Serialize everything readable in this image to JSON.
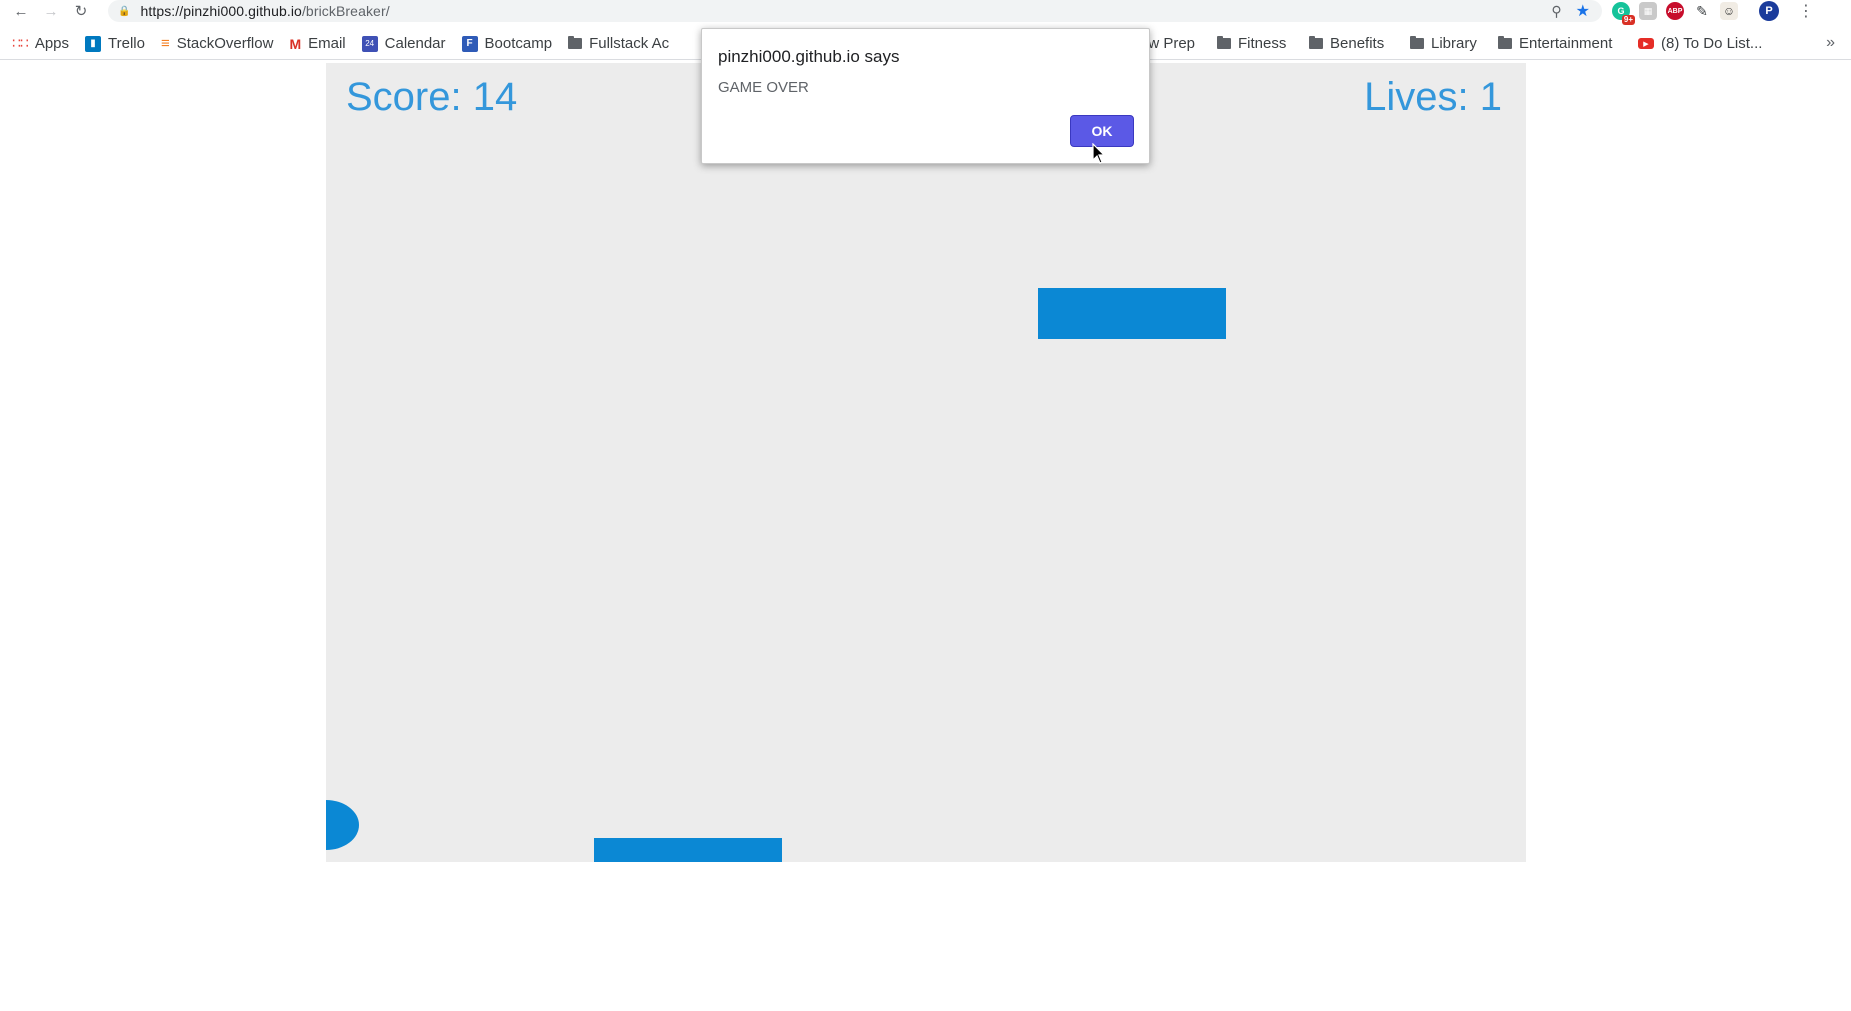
{
  "browser": {
    "url_host": "https://pinzhi000.github.io",
    "url_path": "/brickBreaker/",
    "icons": [
      "back-arrow-icon",
      "forward-arrow-icon",
      "reload-icon",
      "lock-icon",
      "zoom-icon",
      "star-icon",
      "menu-dots-icon"
    ],
    "extensions": {
      "grammarly_badge": "9+",
      "abp": "ABP",
      "profile_initial": "P"
    }
  },
  "bookmarks": [
    {
      "label": "Apps",
      "icon": "apps-grid-icon"
    },
    {
      "label": "Trello",
      "icon": "trello-icon"
    },
    {
      "label": "StackOverflow",
      "icon": "stackoverflow-icon"
    },
    {
      "label": "Email",
      "icon": "gmail-icon"
    },
    {
      "label": "Calendar",
      "icon": "calendar-icon"
    },
    {
      "label": "Bootcamp",
      "icon": "fullstack-icon"
    },
    {
      "label": "Fullstack Ac",
      "icon": "folder-icon"
    },
    {
      "label": "ew Prep",
      "icon": "folder-icon"
    },
    {
      "label": "Fitness",
      "icon": "folder-icon"
    },
    {
      "label": "Benefits",
      "icon": "folder-icon"
    },
    {
      "label": "Library",
      "icon": "folder-icon"
    },
    {
      "label": "Entertainment",
      "icon": "folder-icon"
    },
    {
      "label": "(8) To Do List...",
      "icon": "youtube-icon"
    }
  ],
  "bookmarks_overflow": "»",
  "game": {
    "score_label": "Score: 14",
    "lives_label": "Lives: 1",
    "accent_color": "#0b88d4",
    "hud_color": "#3497db",
    "background_color": "#ececec"
  },
  "alert": {
    "title": "pinzhi000.github.io says",
    "message": "GAME OVER",
    "ok_label": "OK",
    "button_color": "#5b59e6"
  }
}
